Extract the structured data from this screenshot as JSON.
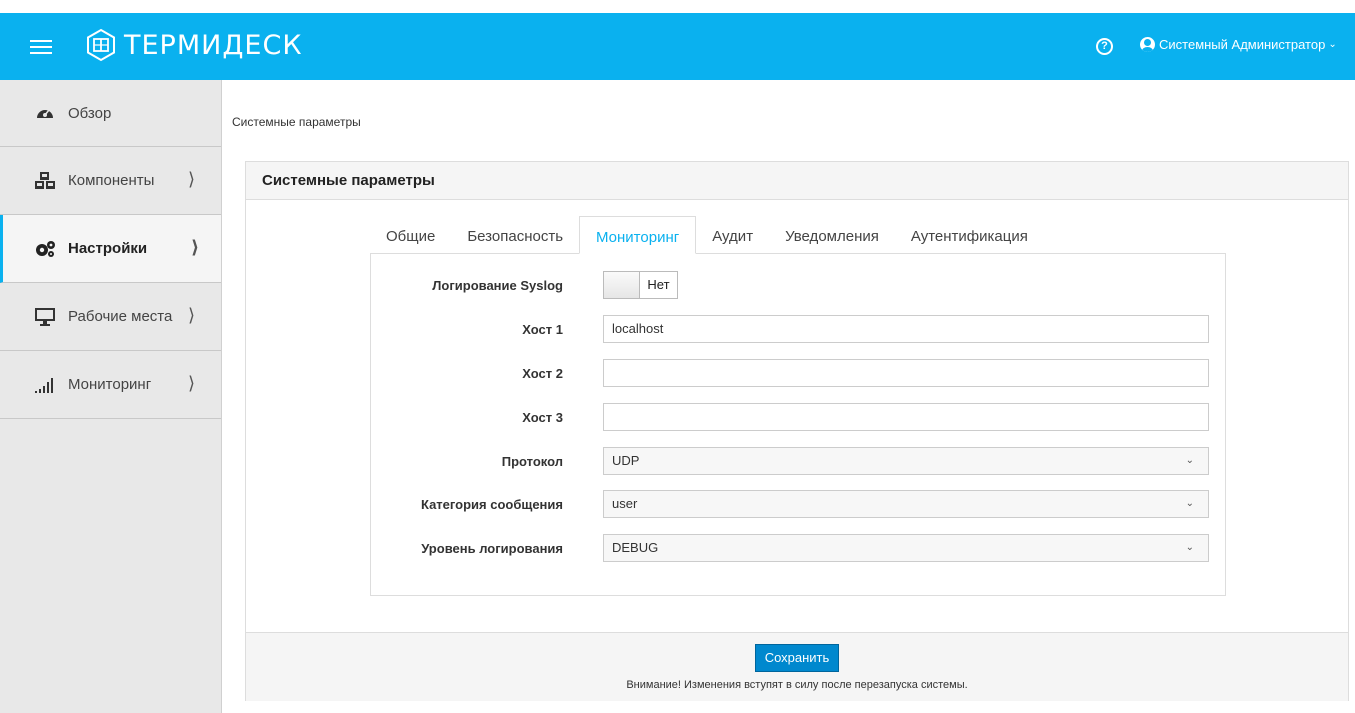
{
  "header": {
    "logo_text": "ТЕРМИДЕСК",
    "help_glyph": "?",
    "user_name": "Системный Администратор",
    "accent_color": "#0ab1ef"
  },
  "sidebar": {
    "items": [
      {
        "label": "Обзор",
        "icon": "dashboard-icon",
        "has_arrow": false
      },
      {
        "label": "Компоненты",
        "icon": "cubes-icon",
        "has_arrow": true
      },
      {
        "label": "Настройки",
        "icon": "cogs-icon",
        "has_arrow": true,
        "active": true
      },
      {
        "label": "Рабочие места",
        "icon": "desktop-icon",
        "has_arrow": true
      },
      {
        "label": "Мониторинг",
        "icon": "signal-bars-icon",
        "has_arrow": true
      }
    ]
  },
  "breadcrumb": "Системные параметры",
  "panel": {
    "title": "Системные параметры",
    "tabs": [
      "Общие",
      "Безопасность",
      "Мониторинг",
      "Аудит",
      "Уведомления",
      "Аутентификация"
    ],
    "active_tab": "Мониторинг",
    "form": {
      "syslog_label": "Логирование Syslog",
      "syslog_value": "Нет",
      "host1_label": "Хост 1",
      "host1_value": "localhost",
      "host2_label": "Хост 2",
      "host2_value": "",
      "host3_label": "Хост 3",
      "host3_value": "",
      "protocol_label": "Протокол",
      "protocol_value": "UDP",
      "category_label": "Категория сообщения",
      "category_value": "user",
      "level_label": "Уровень логирования",
      "level_value": "DEBUG"
    },
    "save_label": "Сохранить",
    "notice": "Внимание! Изменения вступят в силу после перезапуска системы."
  }
}
